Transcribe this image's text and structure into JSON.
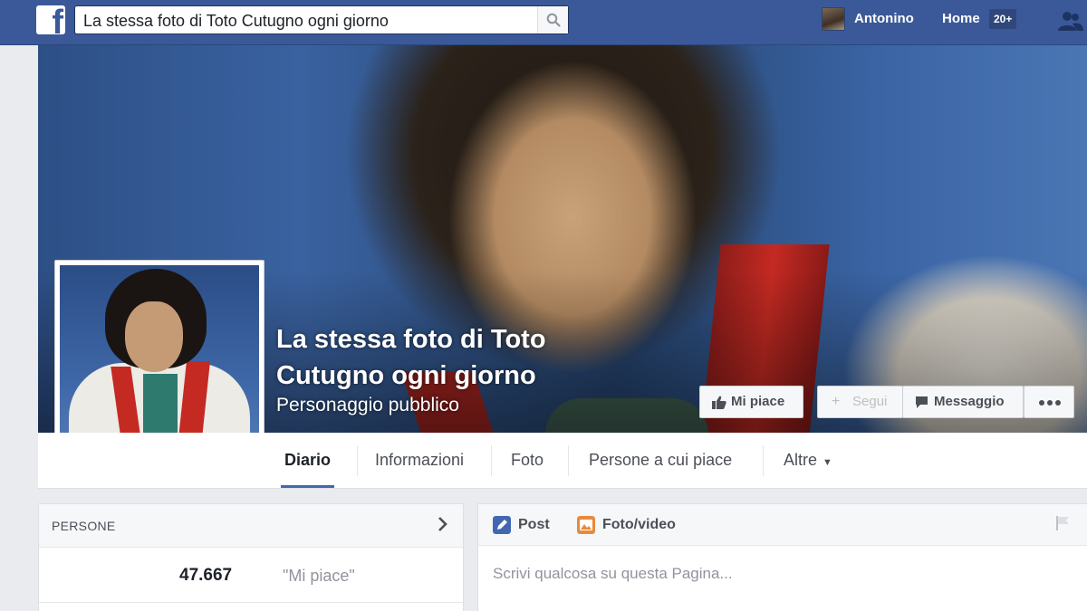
{
  "topbar": {
    "logo_icon": "facebook-f-logo",
    "search_value": "La stessa foto di Toto Cutugno ogni giorno",
    "search_icon": "search-icon",
    "user_name": "Antonino",
    "home_label": "Home",
    "home_badge": "20+",
    "friends_icon": "friend-requests-icon",
    "brand_color": "#3b5998"
  },
  "cover": {
    "page_title": "La stessa foto di Toto Cutugno ogni giorno",
    "category": "Personaggio pubblico"
  },
  "actions": {
    "like_label": "Mi piace",
    "follow_label": "Segui",
    "message_label": "Messaggio",
    "more_icon": "more-dots-icon"
  },
  "tabs": [
    {
      "label": "Diario",
      "active": true
    },
    {
      "label": "Informazioni",
      "active": false
    },
    {
      "label": "Foto",
      "active": false
    },
    {
      "label": "Persone a cui piace",
      "active": false
    },
    {
      "label": "Altre",
      "active": false
    }
  ],
  "people_card": {
    "header": "PERSONE",
    "likes_count": "47.667",
    "likes_label": "\"Mi piace\""
  },
  "composer": {
    "post_tab": "Post",
    "photo_tab": "Foto/video",
    "placeholder": "Scrivi qualcosa su questa Pagina..."
  }
}
